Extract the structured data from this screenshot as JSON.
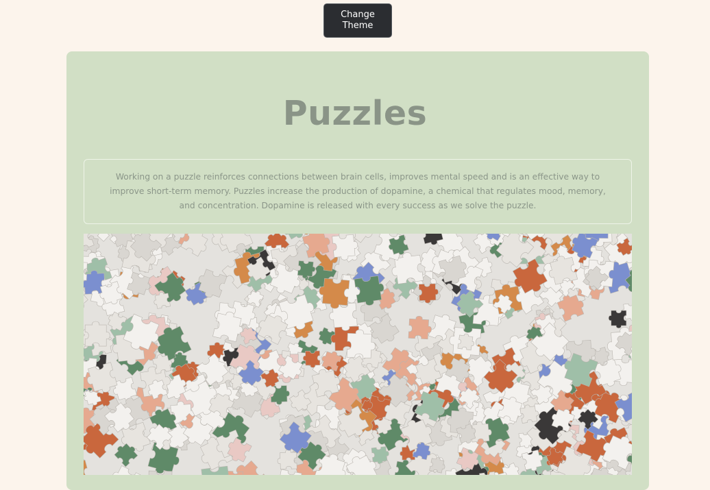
{
  "toolbar": {
    "change_theme_label": "Change Theme"
  },
  "card": {
    "title": "Puzzles",
    "description": "Working on a puzzle reinforces connections between brain cells, improves mental speed and is an effective way to improve short-term memory. Puzzles increase the production of dopamine, a chemical that regulates mood, memory, and concentration. Dopamine is released with every success as we solve the puzzle."
  },
  "colors": {
    "page_background": "#fcf4ec",
    "card_background": "#d1dfc5",
    "title_text": "#8a9487",
    "button_background": "#2b2d31",
    "piece_palette": [
      "#f3f1ee",
      "#e7e4df",
      "#d9d6d1",
      "#c9673d",
      "#5f8a68",
      "#9fbfa8",
      "#7b8fcf",
      "#e6a98f",
      "#d48a4a",
      "#3a3838",
      "#e9c9c4"
    ]
  },
  "image": {
    "subject": "pile of scattered jigsaw puzzle pieces"
  }
}
